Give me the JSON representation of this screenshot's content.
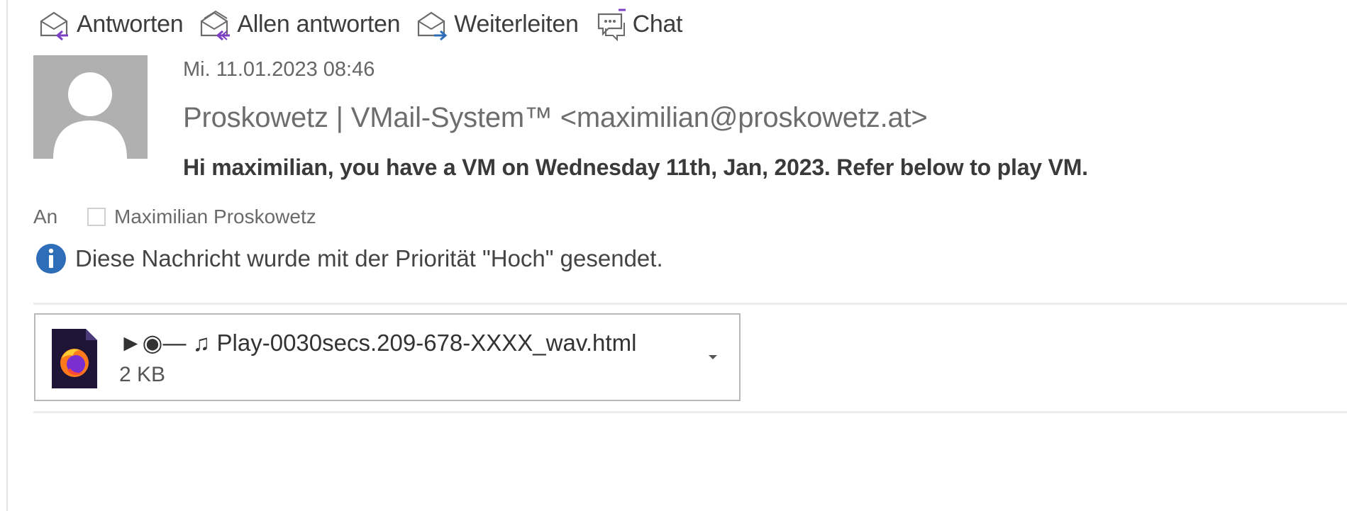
{
  "toolbar": {
    "reply": {
      "label": "Antworten",
      "icon": "reply-envelope-icon"
    },
    "reply_all": {
      "label": "Allen antworten",
      "icon": "reply-all-envelope-icon"
    },
    "forward": {
      "label": "Weiterleiten",
      "icon": "forward-envelope-icon"
    },
    "chat": {
      "label": "Chat",
      "icon": "chat-bubble-icon"
    }
  },
  "message": {
    "date": "Mi. 11.01.2023 08:46",
    "sender": "Proskowetz | VMail-System™ <maximilian@proskowetz.at>",
    "subject": "Hi maximilian, you have a VM on Wednesday 11th, Jan, 2023. Refer below to play VM.",
    "to_label": "An",
    "recipient": "Maximilian Proskowetz",
    "info_text": "Diese Nachricht wurde mit der Priorität \"Hoch\" gesendet."
  },
  "attachment": {
    "name": "►◉— ♫ Play-0030secs.209-678-XXXX_wav.html",
    "size": "2 KB",
    "icon": "firefox-html-file-icon"
  },
  "colors": {
    "text_primary": "#3a3a3a",
    "text_secondary": "#6d6d6d",
    "info_blue": "#2e6db8",
    "avatar_gray": "#b0b0b0",
    "accent_purple": "#7b3fc4"
  }
}
